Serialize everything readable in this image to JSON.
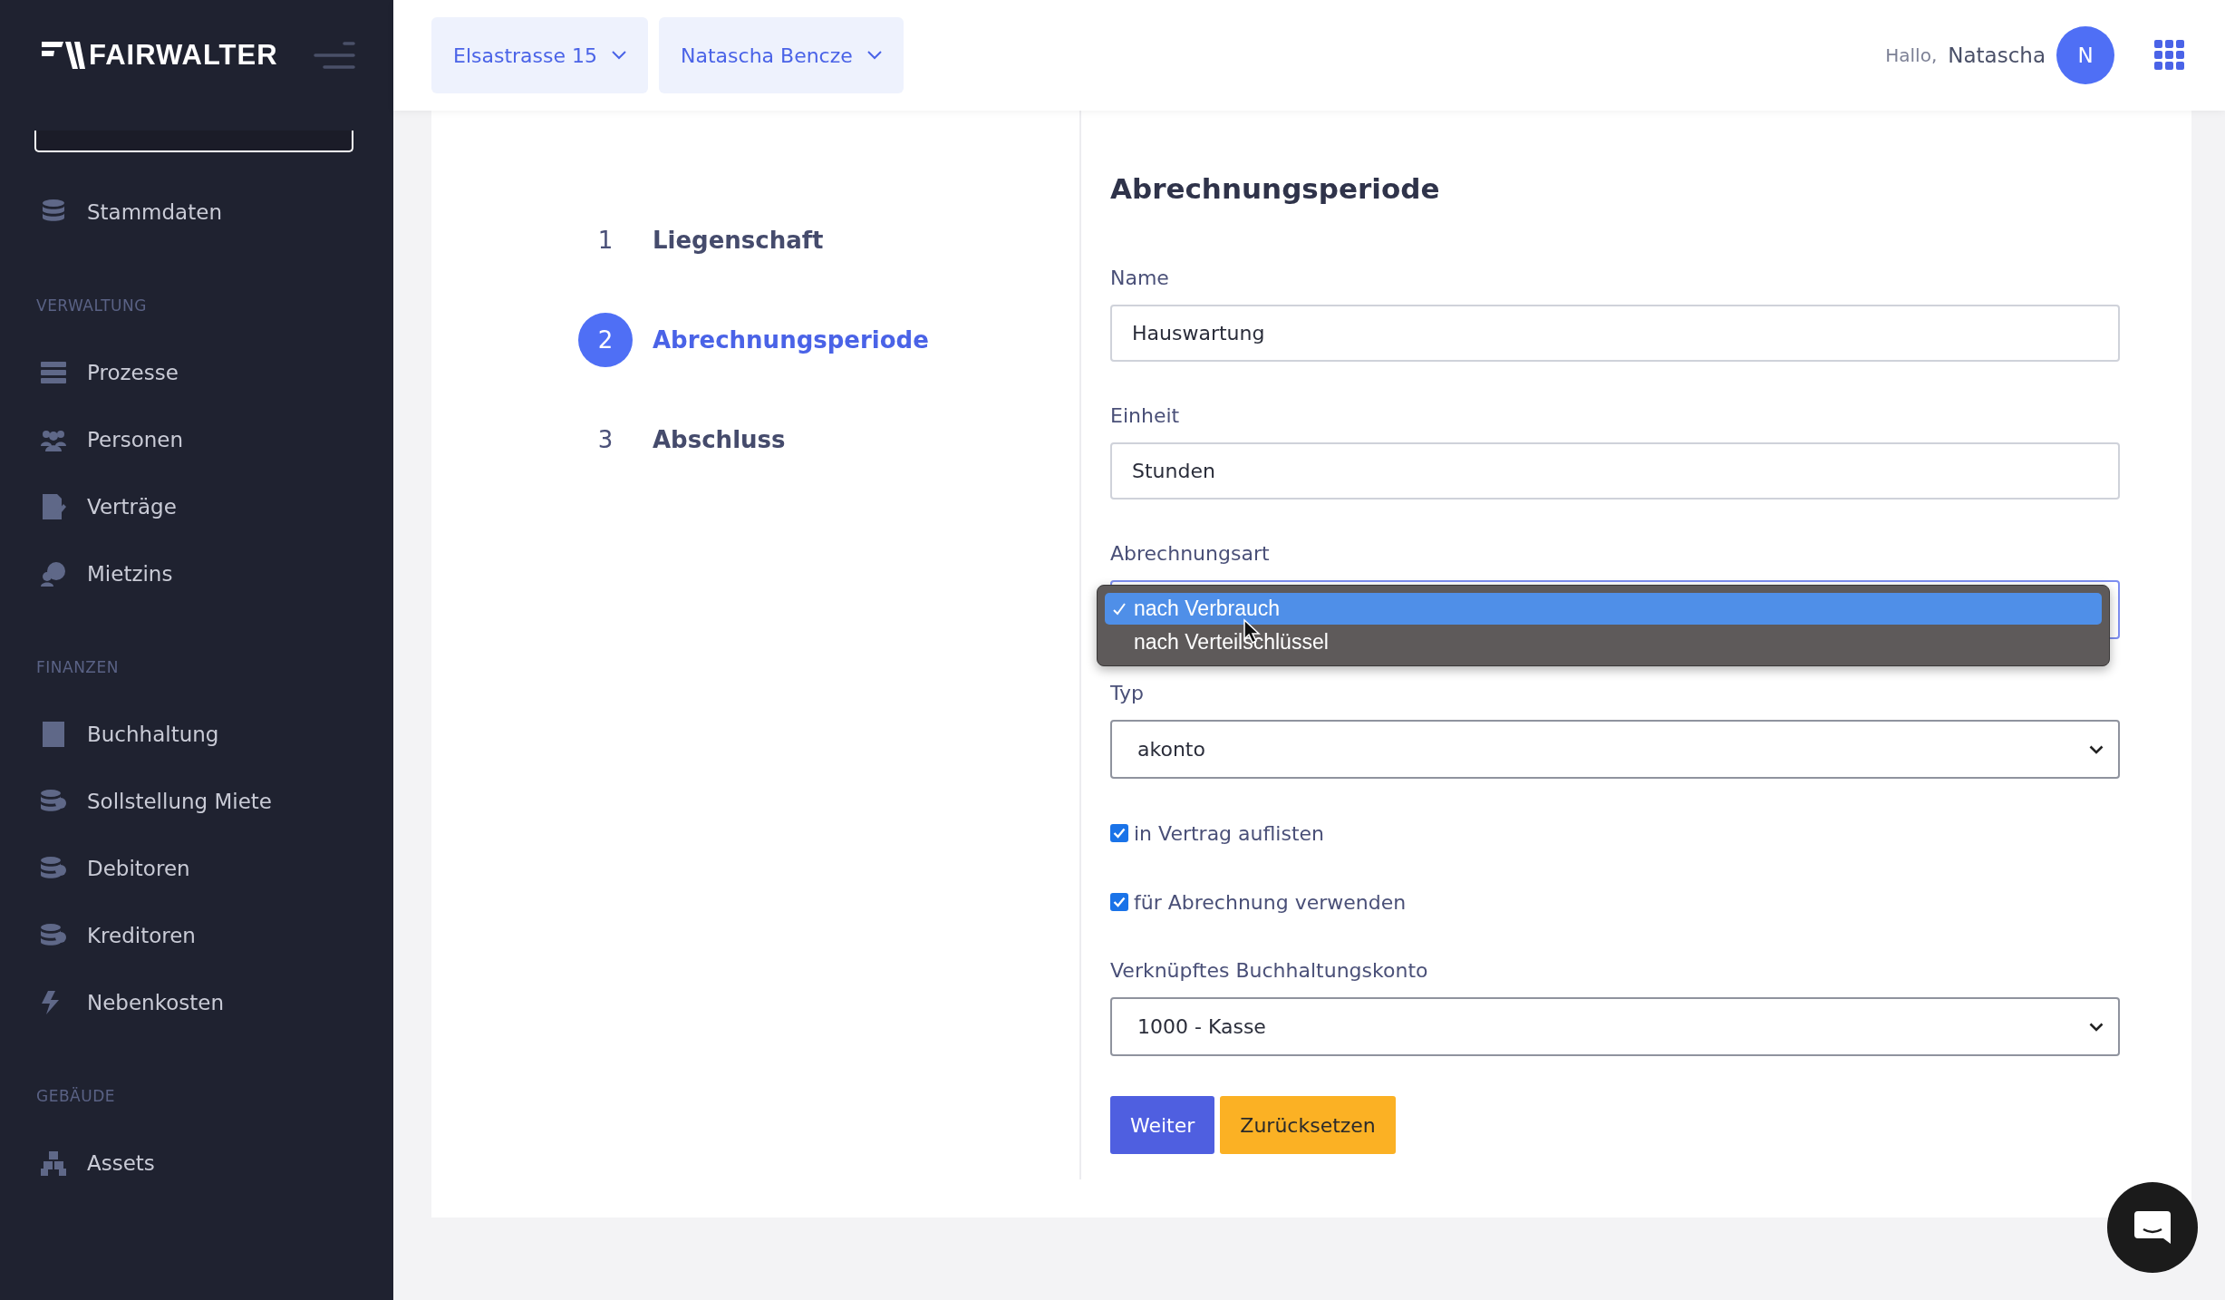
{
  "sidebar": {
    "logo": "FAIRWALTER",
    "sections": [
      {
        "items": [
          {
            "label": "Stammdaten"
          }
        ]
      },
      {
        "title": "VERWALTUNG",
        "items": [
          {
            "label": "Prozesse"
          },
          {
            "label": "Personen"
          },
          {
            "label": "Verträge"
          },
          {
            "label": "Mietzins"
          }
        ]
      },
      {
        "title": "FINANZEN",
        "items": [
          {
            "label": "Buchhaltung"
          },
          {
            "label": "Sollstellung Miete"
          },
          {
            "label": "Debitoren"
          },
          {
            "label": "Kreditoren"
          },
          {
            "label": "Nebenkosten"
          }
        ]
      },
      {
        "title": "GEBÄUDE",
        "items": [
          {
            "label": "Assets"
          }
        ]
      }
    ]
  },
  "topbar": {
    "selectors": [
      {
        "label": "Elsastrasse 15"
      },
      {
        "label": "Natascha Bencze"
      }
    ],
    "greeting": "Hallo,",
    "user": "Natascha",
    "avatar": "N"
  },
  "stepper": [
    {
      "number": "1",
      "label": "Liegenschaft",
      "selected": false
    },
    {
      "number": "2",
      "label": "Abrechnungsperiode",
      "selected": true
    },
    {
      "number": "3",
      "label": "Abschluss",
      "selected": false
    }
  ],
  "form": {
    "title": "Abrechnungsperiode",
    "fields": [
      {
        "kind": "text",
        "label": "Name",
        "value": "Hauswartung"
      },
      {
        "kind": "text",
        "label": "Einheit",
        "value": "Stunden"
      },
      {
        "kind": "open-select",
        "label": "Abrechnungsart",
        "options": [
          {
            "label": "nach Verbrauch",
            "selected": true
          },
          {
            "label": "nach Verteilschlüssel",
            "selected": false
          }
        ]
      },
      {
        "kind": "select",
        "label": "Typ",
        "value": "akonto"
      },
      {
        "kind": "checkbox",
        "label": "in Vertrag auflisten",
        "checked": true
      },
      {
        "kind": "checkbox",
        "label": "für Abrechnung verwenden",
        "checked": true
      },
      {
        "kind": "select",
        "label": "Verknüpftes Buchhaltungskonto",
        "value": "1000 - Kasse"
      }
    ],
    "buttons": [
      {
        "label": "Weiter",
        "kind": "primary"
      },
      {
        "label": "Zurücksetzen",
        "kind": "warning"
      }
    ]
  }
}
